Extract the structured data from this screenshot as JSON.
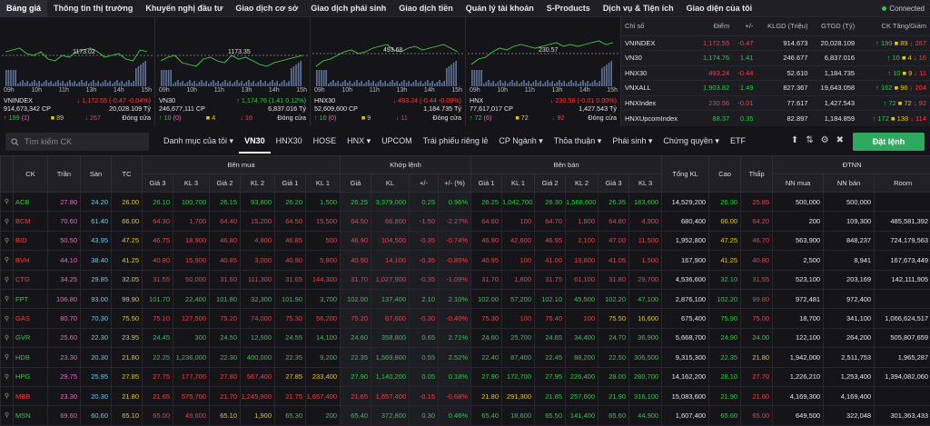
{
  "nav": {
    "items": [
      "Bảng giá",
      "Thông tin thị trường",
      "Khuyến nghị đầu tư",
      "Giao dịch cơ sở",
      "Giao dịch phái sinh",
      "Giao dịch tiền",
      "Quản lý tài khoản",
      "S-Products",
      "Dịch vụ & Tiện ích",
      "Giao diện của tôi"
    ],
    "connected": "Connected"
  },
  "charts": [
    {
      "ref_label": "1173.02",
      "times": [
        "09h",
        "10h",
        "11h",
        "13h",
        "14h",
        "15h"
      ],
      "name": "VNINDEX",
      "change": "1,172.55 (-0.47 -0.04%)",
      "vol": "914,673,342 CP",
      "val": "20,028.109 Tỷ",
      "up": "199",
      "ref": "89",
      "down": "267",
      "ceil": "(1)",
      "status": "Đóng cửa"
    },
    {
      "ref_label": "1173.35",
      "times": [
        "09h",
        "10h",
        "11h",
        "13h",
        "14h",
        "15h"
      ],
      "name": "VN30",
      "change": "1,174.76 (1.41 0.12%)",
      "vol": "246,677,111 CP",
      "val": "6,837.016 Tỷ",
      "up": "10",
      "ref": "4",
      "down": "16",
      "ceil": "(0)",
      "status": "Đóng cửa"
    },
    {
      "ref_label": "493.68",
      "times": [
        "09h",
        "10h",
        "11h",
        "13h",
        "14h",
        "15h"
      ],
      "name": "HNX30",
      "change": "493.24 (-0.44 -0.09%)",
      "vol": "52,609,600 CP",
      "val": "1,184.735 Tỷ",
      "up": "10",
      "ref": "9",
      "down": "11",
      "ceil": "(0)",
      "status": "Đóng cửa"
    },
    {
      "ref_label": "230.57",
      "times": [
        "09h",
        "10h",
        "11h",
        "13h",
        "14h",
        "15h"
      ],
      "name": "HNX",
      "change": "230.56 (-0.01 0.00%)",
      "vol": "77,617,017 CP",
      "val": "1,427.543 Tỷ",
      "up": "72",
      "ref": "72",
      "down": "92",
      "ceil": "(6)",
      "status": "Đóng cửa"
    }
  ],
  "index_table": {
    "headers": [
      "Chỉ số",
      "Điểm",
      "+/-",
      "KLGD (Triệu)",
      "GTGD (Tỷ)",
      "CK Tăng/Giảm"
    ],
    "rows": [
      {
        "name": "VNINDEX",
        "point": "1,172.55",
        "chg": "-0.47",
        "klgd": "914.673",
        "gtgd": "20,028.109",
        "up": "199",
        "ref": "89",
        "down": "267",
        "pc": "r"
      },
      {
        "name": "VN30",
        "point": "1,174.76",
        "chg": "1.41",
        "klgd": "246.677",
        "gtgd": "6,837.016",
        "up": "10",
        "ref": "4",
        "down": "16",
        "pc": "g"
      },
      {
        "name": "HNX30",
        "point": "493.24",
        "chg": "-0.44",
        "klgd": "52.610",
        "gtgd": "1,184.735",
        "up": "10",
        "ref": "9",
        "down": "11",
        "pc": "r"
      },
      {
        "name": "VNXALL",
        "point": "1,903.82",
        "chg": "1.49",
        "klgd": "827.367",
        "gtgd": "19,643.058",
        "up": "162",
        "ref": "96",
        "down": "204",
        "pc": "g"
      },
      {
        "name": "HNXIndex",
        "point": "230.56",
        "chg": "-0.01",
        "klgd": "77.617",
        "gtgd": "1,427.543",
        "up": "72",
        "ref": "72",
        "down": "92",
        "pc": "r"
      },
      {
        "name": "HNXUpcomIndex",
        "point": "88.37",
        "chg": "0.35",
        "klgd": "82.897",
        "gtgd": "1,184.859",
        "up": "172",
        "ref": "138",
        "down": "114",
        "pc": "g"
      }
    ]
  },
  "toolbar": {
    "search_placeholder": "Tìm kiếm CK",
    "tabs": [
      "Danh mục của tôi",
      "VN30",
      "HNX30",
      "HOSE",
      "HNX",
      "UPCOM",
      "Trái phiếu riêng lẻ",
      "CP Ngành",
      "Thỏa thuận",
      "Phái sinh",
      "Chứng quyền",
      "ETF"
    ],
    "order_label": "Đặt lệnh"
  },
  "grid": {
    "group_headers": [
      "Bên mua",
      "Khớp lệnh",
      "Bên bán",
      "ĐTNN"
    ],
    "headers": [
      "CK",
      "Trần",
      "Sàn",
      "TC",
      "Giá 3",
      "KL 3",
      "Giá 2",
      "KL 2",
      "Giá 1",
      "KL 1",
      "Giá",
      "KL",
      "+/-",
      "+/- (%)",
      "Giá 1",
      "KL 1",
      "Giá 2",
      "KL 2",
      "Giá 3",
      "KL 3",
      "Tổng KL",
      "Cao",
      "Thấp",
      "NN mua",
      "NN bán",
      "Room"
    ],
    "rows": [
      {
        "c": [
          "ACB",
          "27.80",
          "24.20",
          "26.00",
          "26.10",
          "100,700",
          "26.15",
          "93,800",
          "26.20",
          "1,500",
          "26.25",
          "3,379,000",
          "0.25",
          "0.96%",
          "26.25",
          "1,042,700",
          "26.30",
          "1,568,600",
          "26.35",
          "183,600",
          "14,529,200",
          "26.30",
          "25.85",
          "500,000",
          "500,000",
          ""
        ],
        "k": "gg"
      },
      {
        "c": [
          "BCM",
          "70.60",
          "61.40",
          "66.00",
          "64.30",
          "1,700",
          "64.40",
          "15,200",
          "64.50",
          "15,500",
          "64.50",
          "66,800",
          "-1.50",
          "-2.27%",
          "64.60",
          "100",
          "64.70",
          "1,800",
          "64.80",
          "4,900",
          "680,400",
          "66.00",
          "64.20",
          "200",
          "109,300",
          "485,581,392"
        ],
        "k": "rr"
      },
      {
        "c": [
          "BID",
          "50.50",
          "43.95",
          "47.25",
          "46.75",
          "18,900",
          "46.80",
          "4,800",
          "46.85",
          "500",
          "46.90",
          "104,500",
          "-0.35",
          "-0.74%",
          "46.90",
          "42,600",
          "46.95",
          "2,100",
          "47.00",
          "11,500",
          "1,952,800",
          "47.25",
          "46.70",
          "563,900",
          "848,237",
          "724,179,563"
        ],
        "k": "rr"
      },
      {
        "c": [
          "BVH",
          "44.10",
          "38.40",
          "41.25",
          "40.80",
          "15,900",
          "40.85",
          "3,000",
          "40.90",
          "5,800",
          "40.90",
          "14,100",
          "-0.35",
          "-0.85%",
          "40.95",
          "100",
          "41.00",
          "13,600",
          "41.05",
          "1,500",
          "167,900",
          "41.25",
          "40.80",
          "2,500",
          "8,941",
          "167,673,449"
        ],
        "k": "rr"
      },
      {
        "c": [
          "CTG",
          "34.25",
          "29.85",
          "32.05",
          "31.55",
          "50,000",
          "31.60",
          "111,300",
          "31.65",
          "144,300",
          "31.70",
          "1,027,900",
          "-0.35",
          "-1.09%",
          "31.70",
          "1,800",
          "31.75",
          "61,100",
          "31.80",
          "29,700",
          "4,536,600",
          "32.10",
          "31.55",
          "523,100",
          "203,169",
          "142,111,905"
        ],
        "k": "rr"
      },
      {
        "c": [
          "FPT",
          "106.80",
          "93.00",
          "99.90",
          "101.70",
          "22,400",
          "101.80",
          "32,300",
          "101.90",
          "3,700",
          "102.00",
          "137,400",
          "2.10",
          "2.10%",
          "102.00",
          "57,200",
          "102.10",
          "45,500",
          "102.20",
          "47,100",
          "2,876,100",
          "102.20",
          "99.80",
          "972,481",
          "972,400",
          ""
        ],
        "k": "gg"
      },
      {
        "c": [
          "GAS",
          "80.70",
          "70.30",
          "75.50",
          "75.10",
          "127,500",
          "75.20",
          "74,000",
          "75.30",
          "56,200",
          "75.20",
          "67,600",
          "-0.30",
          "-0.40%",
          "75.30",
          "100",
          "75.40",
          "100",
          "75.50",
          "16,600",
          "675,400",
          "75.90",
          "75.00",
          "18,700",
          "341,100",
          "1,066,624,517"
        ],
        "k": "rr"
      },
      {
        "c": [
          "GVR",
          "25.60",
          "22.30",
          "23.95",
          "24.45",
          "300",
          "24.50",
          "12,500",
          "24.55",
          "14,100",
          "24.60",
          "358,800",
          "0.65",
          "2.71%",
          "24.60",
          "25,700",
          "24.65",
          "34,400",
          "24.70",
          "36,900",
          "5,668,700",
          "24.90",
          "24.00",
          "122,100",
          "264,200",
          "505,807,659"
        ],
        "k": "gg"
      },
      {
        "c": [
          "HDB",
          "23.30",
          "20.30",
          "21.80",
          "22.25",
          "1,236,000",
          "22.30",
          "400,000",
          "22.35",
          "9,200",
          "22.35",
          "1,569,800",
          "0.55",
          "2.52%",
          "22.40",
          "87,400",
          "22.45",
          "88,200",
          "22.50",
          "306,500",
          "9,315,300",
          "22.35",
          "21.80",
          "1,942,000",
          "2,511,753",
          "1,965,287"
        ],
        "k": "gg"
      },
      {
        "c": [
          "HPG",
          "29.75",
          "25.95",
          "27.85",
          "27.75",
          "177,700",
          "27.80",
          "567,400",
          "27.85",
          "233,400",
          "27.90",
          "1,140,200",
          "0.05",
          "0.18%",
          "27.90",
          "172,700",
          "27.95",
          "226,400",
          "28.00",
          "280,700",
          "14,162,200",
          "28.10",
          "27.70",
          "1,226,210",
          "1,253,400",
          "1,394,082,060"
        ],
        "k": "gg"
      },
      {
        "c": [
          "MBB",
          "23.30",
          "20.30",
          "21.80",
          "21.65",
          "575,700",
          "21.70",
          "1,245,900",
          "21.75",
          "1,657,400",
          "21.65",
          "1,657,400",
          "-0.15",
          "-0.68%",
          "21.80",
          "291,300",
          "21.85",
          "257,600",
          "21.90",
          "316,100",
          "15,083,600",
          "21.90",
          "21.60",
          "4,169,300",
          "4,169,400",
          ""
        ],
        "k": "rr"
      },
      {
        "c": [
          "MSN",
          "69.60",
          "60.60",
          "65.10",
          "65.00",
          "49,600",
          "65.10",
          "1,900",
          "65.30",
          "200",
          "65.40",
          "372,800",
          "0.30",
          "0.46%",
          "65.40",
          "18,600",
          "65.50",
          "141,400",
          "65.60",
          "44,900",
          "1,607,400",
          "65.60",
          "65.00",
          "649,500",
          "322,048",
          "301,363,433"
        ],
        "k": "gg"
      }
    ]
  },
  "colors": {
    "up": "#2ecc40",
    "down": "#ff3b3b",
    "ref": "#e8c80f",
    "ceil": "#ff5ccf",
    "floor": "#4fd7ff",
    "accent": "#2eaa5f"
  }
}
